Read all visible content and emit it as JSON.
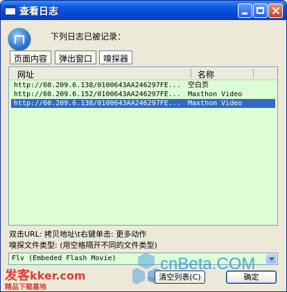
{
  "window": {
    "title": "查看日志"
  },
  "header": {
    "text": "下列日志已被记录："
  },
  "tabs": [
    {
      "label": "页面内容"
    },
    {
      "label": "弹出窗口"
    },
    {
      "label": "嗅探器"
    }
  ],
  "list": {
    "columns": {
      "url": "网址",
      "name": "名称"
    },
    "rows": [
      {
        "url": "http://60.209.6.138/0100643AA246297FE...",
        "name": "空白页"
      },
      {
        "url": "http://60.209.6.152/0100643AA246297FE...",
        "name": "Maxthon Video"
      },
      {
        "url": "http://60.209.6.138/0100643AA246297FE...",
        "name": "Maxthon Video",
        "selected": true
      }
    ]
  },
  "hints": {
    "line1": "双击URL: 拷贝地址\\t右键单击: 更多动作",
    "line2": "嗅探文件类型: (用空格隔开不同的文件类型)"
  },
  "filetype": {
    "value": "Flv (Embeded Flash Movie)"
  },
  "buttons": {
    "clear": "清空列表(C)",
    "ok": "确定"
  },
  "watermark": {
    "site": "kker.com",
    "site_prefix": "发客",
    "sub": "精品下载基地",
    "brand": "cnBeta.COM",
    "tm": "TM"
  },
  "colors": {
    "title_bar": "#0646d4",
    "list_bg": "#dcfed5",
    "selection": "#316ac5",
    "watermark_red": "#d2241f",
    "cnbeta_blue": "#1b8fd6"
  }
}
